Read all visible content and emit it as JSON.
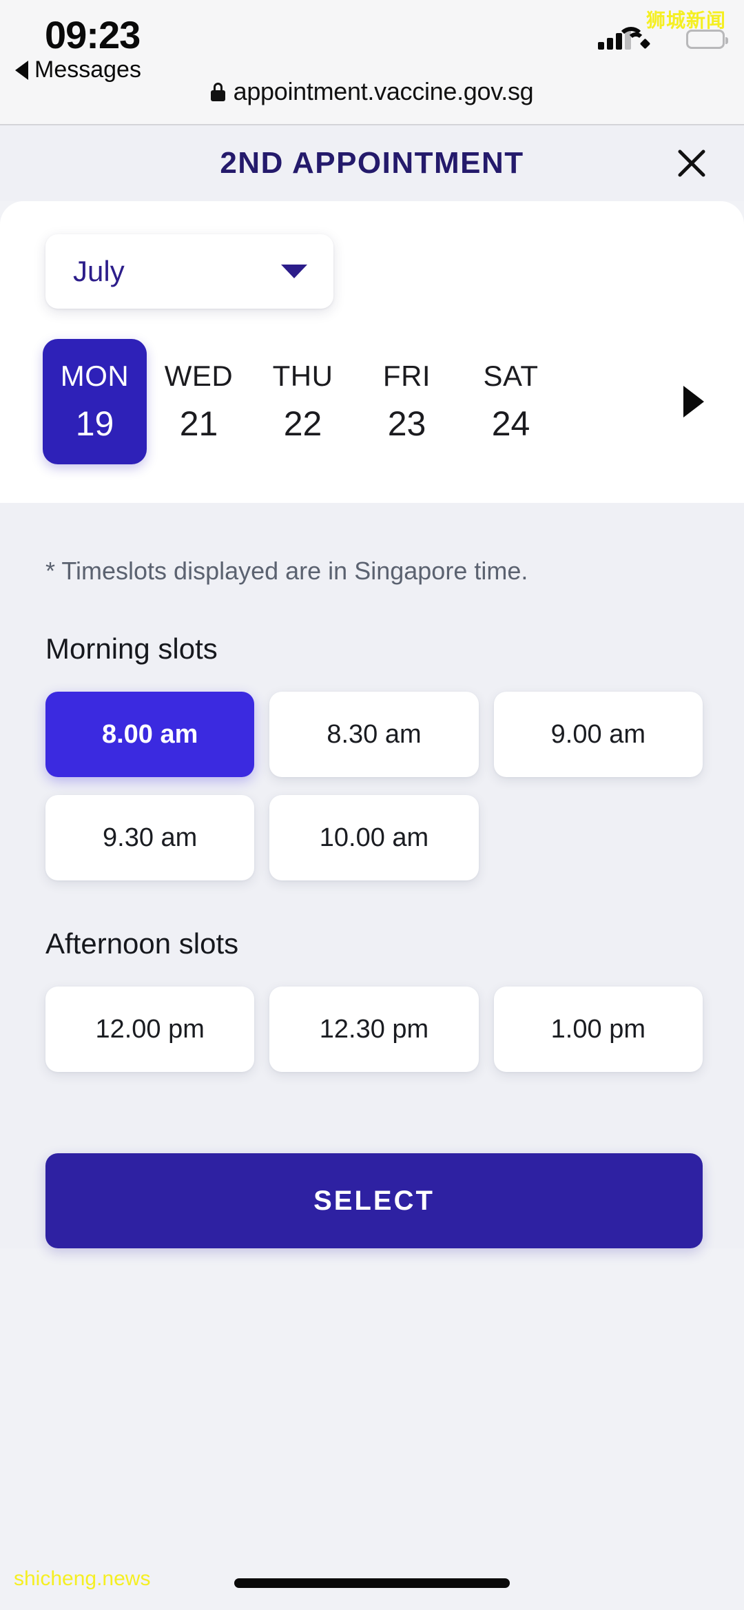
{
  "status_bar": {
    "time": "09:23",
    "back_label": "Messages",
    "back_icon": "triangle-left-icon",
    "signal_icon": "cellular-signal-icon",
    "wifi_icon": "wifi-icon",
    "battery_icon": "battery-full-icon",
    "watermark": "狮城新闻"
  },
  "browser": {
    "lock_icon": "padlock-icon",
    "url": "appointment.vaccine.gov.sg"
  },
  "header": {
    "title": "2ND APPOINTMENT",
    "close_icon": "close-icon",
    "title_color": "#241a6b"
  },
  "calendar": {
    "month": {
      "value": "July",
      "chevron_icon": "chevron-down-icon"
    },
    "next_icon": "triangle-right-icon",
    "dates": [
      {
        "dow": "MON",
        "day": "19",
        "selected": true
      },
      {
        "dow": "WED",
        "day": "21",
        "selected": false
      },
      {
        "dow": "THU",
        "day": "22",
        "selected": false
      },
      {
        "dow": "FRI",
        "day": "23",
        "selected": false
      },
      {
        "dow": "SAT",
        "day": "24",
        "selected": false
      }
    ]
  },
  "slots": {
    "note": "* Timeslots displayed are in Singapore time.",
    "morning_title": "Morning slots",
    "morning": [
      {
        "label": "8.00 am",
        "selected": true
      },
      {
        "label": "8.30 am",
        "selected": false
      },
      {
        "label": "9.00 am",
        "selected": false
      },
      {
        "label": "9.30 am",
        "selected": false
      },
      {
        "label": "10.00 am",
        "selected": false
      }
    ],
    "afternoon_title": "Afternoon slots",
    "afternoon": [
      {
        "label": "12.00 pm",
        "selected": false
      },
      {
        "label": "12.30 pm",
        "selected": false
      },
      {
        "label": "1.00 pm",
        "selected": false
      }
    ]
  },
  "actions": {
    "select_label": "SELECT"
  },
  "footer": {
    "watermark": "shicheng.news",
    "home_indicator": "home-indicator"
  },
  "colors": {
    "selected_date": "#2e21b8",
    "selected_slot": "#3b2ae0",
    "primary_button": "#2e21a2",
    "title": "#241a6b",
    "page_background": "#eff0f5",
    "watermark_yellow": "#f5ef22"
  }
}
